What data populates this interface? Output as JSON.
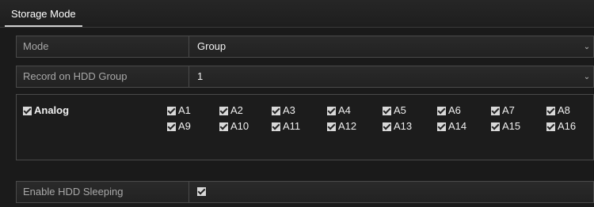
{
  "tab": {
    "label": "Storage Mode"
  },
  "mode": {
    "label": "Mode",
    "value": "Group"
  },
  "record_group": {
    "label": "Record on HDD Group",
    "value": "1"
  },
  "analog": {
    "label": "Analog",
    "checked": true
  },
  "cameras": [
    {
      "label": "A1",
      "checked": true
    },
    {
      "label": "A2",
      "checked": true
    },
    {
      "label": "A3",
      "checked": true
    },
    {
      "label": "A4",
      "checked": true
    },
    {
      "label": "A5",
      "checked": true
    },
    {
      "label": "A6",
      "checked": true
    },
    {
      "label": "A7",
      "checked": true
    },
    {
      "label": "A8",
      "checked": true
    },
    {
      "label": "A9",
      "checked": true
    },
    {
      "label": "A10",
      "checked": true
    },
    {
      "label": "A11",
      "checked": true
    },
    {
      "label": "A12",
      "checked": true
    },
    {
      "label": "A13",
      "checked": true
    },
    {
      "label": "A14",
      "checked": true
    },
    {
      "label": "A15",
      "checked": true
    },
    {
      "label": "A16",
      "checked": true
    }
  ],
  "sleeping": {
    "label": "Enable HDD Sleeping",
    "checked": true
  }
}
